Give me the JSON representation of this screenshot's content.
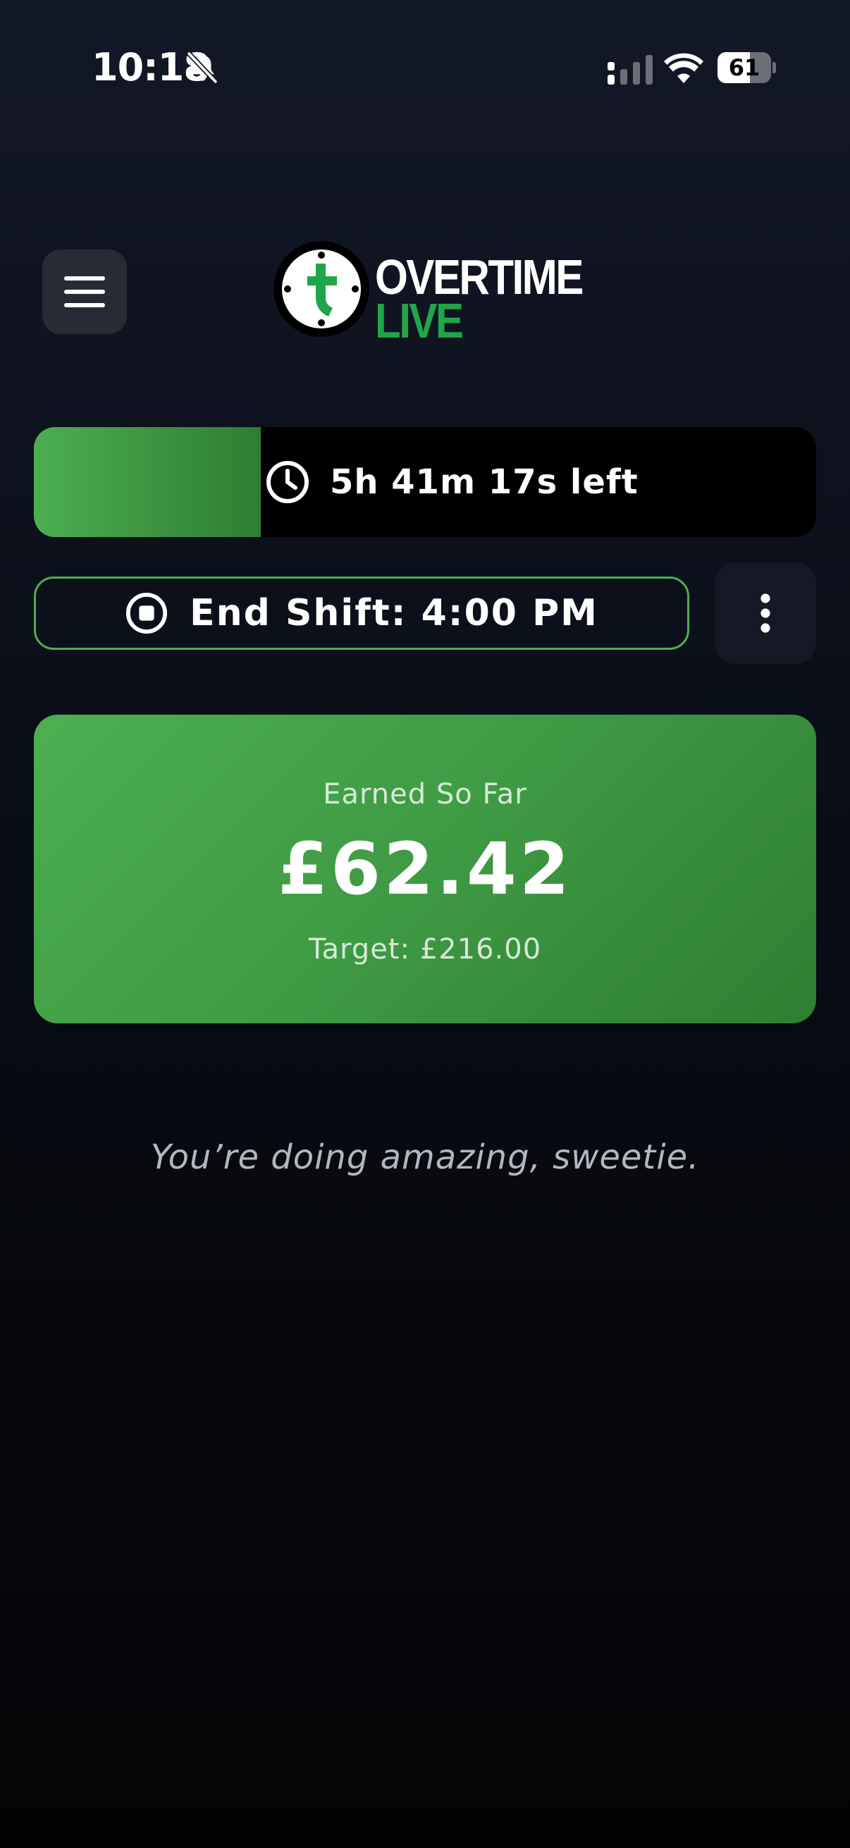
{
  "status_bar": {
    "time": "10:18",
    "battery_level": "61",
    "battery_fraction": 0.61,
    "icons": [
      "bell-slash-icon",
      "cellular-signal-icon",
      "wifi-icon",
      "battery-icon"
    ]
  },
  "header": {
    "menu_icon": "hamburger-menu-icon",
    "logo": {
      "word_top": "OVERTIME",
      "word_bottom": "LIVE",
      "mark_icon": "clock-t-logo-icon"
    }
  },
  "countdown": {
    "text": "5h 41m 17s left",
    "progress_fraction": 0.29,
    "icon": "clock-icon"
  },
  "shift": {
    "end_label": "End Shift: 4:00 PM",
    "end_icon": "stop-circle-icon",
    "more_icon": "more-vertical-icon"
  },
  "earnings": {
    "label": "Earned So Far",
    "value": "£62.42",
    "target": "Target: £216.00"
  },
  "message": "You’re doing amazing, sweetie.",
  "colors": {
    "accent_green": "#4caf50",
    "accent_green_dark": "#2e7d32",
    "logo_green": "#1fa54a",
    "background_top": "#131828",
    "background_bottom": "#030305"
  }
}
